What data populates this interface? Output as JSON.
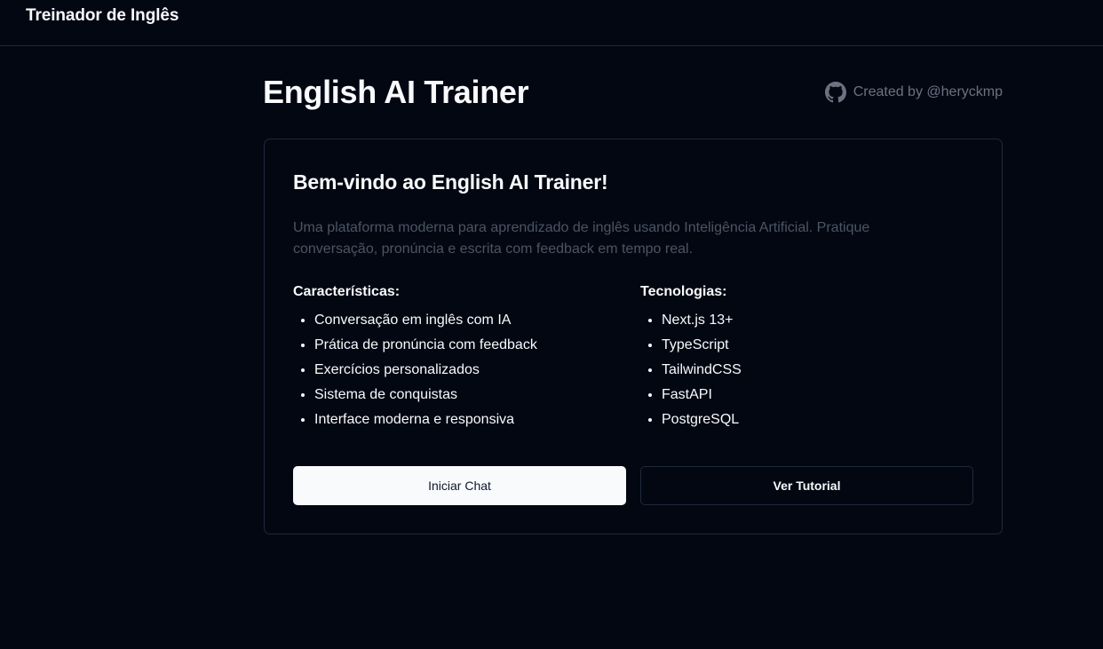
{
  "navbar": {
    "brand": "Treinador de Inglês"
  },
  "header": {
    "title": "English AI Trainer",
    "creator_text": "Created by @heryckmp",
    "creator_icon": "github-icon"
  },
  "card": {
    "title": "Bem-vindo ao English AI Trainer!",
    "description": "Uma plataforma moderna para aprendizado de inglês usando Inteligência Artificial. Pratique conversação, pronúncia e escrita com feedback em tempo real.",
    "features": {
      "title": "Características:",
      "items": [
        "Conversação em inglês com IA",
        "Prática de pronúncia com feedback",
        "Exercícios personalizados",
        "Sistema de conquistas",
        "Interface moderna e responsiva"
      ]
    },
    "technologies": {
      "title": "Tecnologias:",
      "items": [
        "Next.js 13+",
        "TypeScript",
        "TailwindCSS",
        "FastAPI",
        "PostgreSQL"
      ]
    },
    "buttons": {
      "primary_label": "Iniciar Chat",
      "secondary_label": "Ver Tutorial"
    }
  },
  "colors": {
    "background": "#030712",
    "foreground": "#f8fafc",
    "muted": "#4b5563",
    "border": "#1e293b"
  }
}
